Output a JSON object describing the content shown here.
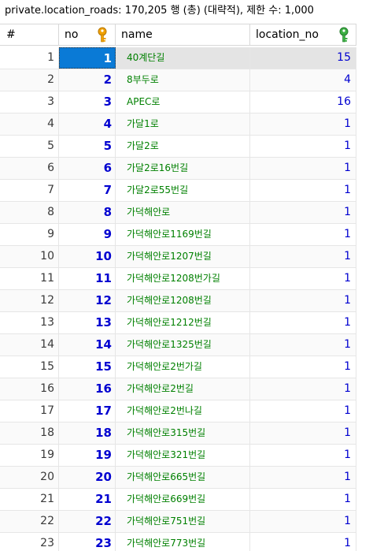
{
  "caption": "private.location_roads: 170,205 행 (총) (대략적), 제한 수: 1,000",
  "columns": {
    "idx": "#",
    "no": "no",
    "name": "name",
    "location_no": "location_no"
  },
  "icons": {
    "no": "primary-key-icon",
    "location_no": "foreign-key-icon"
  },
  "colors": {
    "number_text": "#0000d0",
    "name_text": "#008000",
    "selection": "#0a7ad6",
    "primary_key": "#f0a000",
    "foreign_key": "#3cb043"
  },
  "selected_row": 1,
  "rows": [
    {
      "idx": "1",
      "no": "1",
      "name": "40계단길",
      "location_no": "15"
    },
    {
      "idx": "2",
      "no": "2",
      "name": "8부두로",
      "location_no": "4"
    },
    {
      "idx": "3",
      "no": "3",
      "name": "APEC로",
      "location_no": "16"
    },
    {
      "idx": "4",
      "no": "4",
      "name": "가달1로",
      "location_no": "1"
    },
    {
      "idx": "5",
      "no": "5",
      "name": "가달2로",
      "location_no": "1"
    },
    {
      "idx": "6",
      "no": "6",
      "name": "가달2로16번길",
      "location_no": "1"
    },
    {
      "idx": "7",
      "no": "7",
      "name": "가달2로55번길",
      "location_no": "1"
    },
    {
      "idx": "8",
      "no": "8",
      "name": "가덕해안로",
      "location_no": "1"
    },
    {
      "idx": "9",
      "no": "9",
      "name": "가덕해안로1169번길",
      "location_no": "1"
    },
    {
      "idx": "10",
      "no": "10",
      "name": "가덕해안로1207번길",
      "location_no": "1"
    },
    {
      "idx": "11",
      "no": "11",
      "name": "가덕해안로1208번가길",
      "location_no": "1"
    },
    {
      "idx": "12",
      "no": "12",
      "name": "가덕해안로1208번길",
      "location_no": "1"
    },
    {
      "idx": "13",
      "no": "13",
      "name": "가덕해안로1212번길",
      "location_no": "1"
    },
    {
      "idx": "14",
      "no": "14",
      "name": "가덕해안로1325번길",
      "location_no": "1"
    },
    {
      "idx": "15",
      "no": "15",
      "name": "가덕해안로2번가길",
      "location_no": "1"
    },
    {
      "idx": "16",
      "no": "16",
      "name": "가덕해안로2번길",
      "location_no": "1"
    },
    {
      "idx": "17",
      "no": "17",
      "name": "가덕해안로2번나길",
      "location_no": "1"
    },
    {
      "idx": "18",
      "no": "18",
      "name": "가덕해안로315번길",
      "location_no": "1"
    },
    {
      "idx": "19",
      "no": "19",
      "name": "가덕해안로321번길",
      "location_no": "1"
    },
    {
      "idx": "20",
      "no": "20",
      "name": "가덕해안로665번길",
      "location_no": "1"
    },
    {
      "idx": "21",
      "no": "21",
      "name": "가덕해안로669번길",
      "location_no": "1"
    },
    {
      "idx": "22",
      "no": "22",
      "name": "가덕해안로751번길",
      "location_no": "1"
    },
    {
      "idx": "23",
      "no": "23",
      "name": "가덕해안로773번길",
      "location_no": "1"
    }
  ]
}
